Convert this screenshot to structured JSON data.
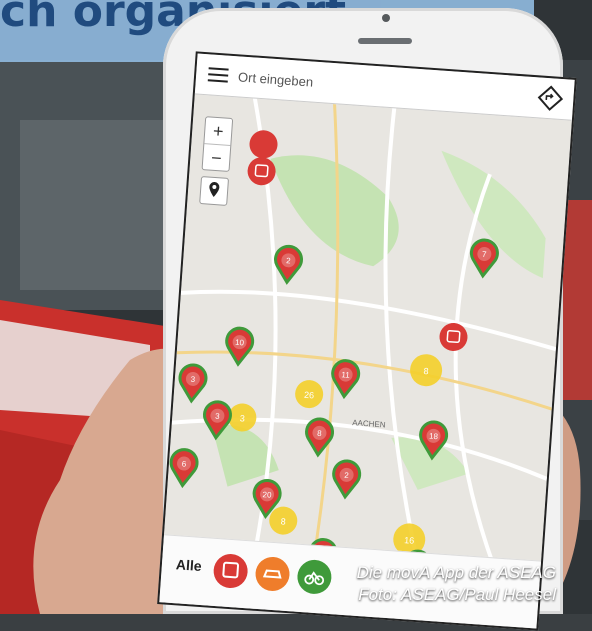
{
  "banner": {
    "text": "ch organisiert."
  },
  "app": {
    "search_placeholder": "Ort eingeben",
    "zoom_in": "+",
    "zoom_out": "−",
    "filter_all_label": "Alle",
    "map_label": "AACHEN",
    "pins": [
      {
        "label": "7"
      },
      {
        "label": "2"
      },
      {
        "label": "10"
      },
      {
        "label": "3"
      },
      {
        "label": "11"
      },
      {
        "label": "3"
      },
      {
        "label": "8"
      },
      {
        "label": "18"
      },
      {
        "label": "2"
      },
      {
        "label": "6"
      },
      {
        "label": "20"
      },
      {
        "label": "6"
      },
      {
        "label": "10"
      }
    ],
    "clusters": [
      {
        "label": "8"
      },
      {
        "label": "26"
      },
      {
        "label": "3"
      },
      {
        "label": "16"
      },
      {
        "label": "8"
      }
    ],
    "filters": [
      {
        "name": "bus",
        "color": "#d93a36"
      },
      {
        "name": "car",
        "color": "#ef7d2b"
      },
      {
        "name": "bike",
        "color": "#3f9a3a"
      }
    ]
  },
  "caption": {
    "line1": "Die movA App der ASEAG",
    "line2": "Foto: ASEAG/Paul Heesel"
  }
}
